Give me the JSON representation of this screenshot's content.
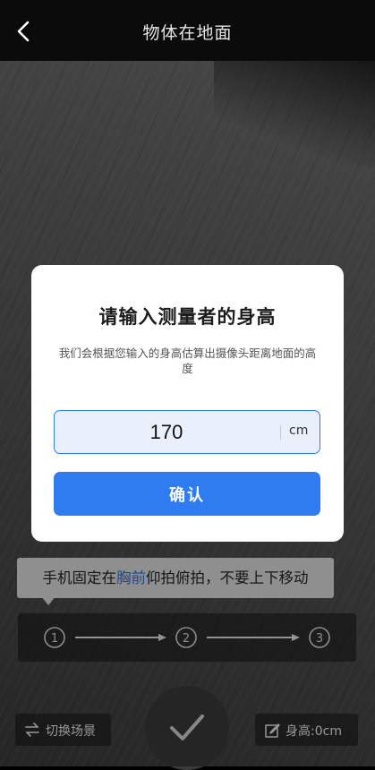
{
  "header": {
    "title": "物体在地面",
    "back_icon": "chevron-left-icon"
  },
  "dialog": {
    "title": "请输入测量者的身高",
    "description": "我们会根据您输入的身高估算出摄像头距离地面的高度",
    "height_value": "170",
    "unit": "cm",
    "confirm_label": "确认",
    "accent_color": "#2f7bf0"
  },
  "tip": {
    "prefix": "手机固定在",
    "highlight": "胸前",
    "suffix": "仰拍俯拍，不要上下移动",
    "highlight_color": "#2f6fd6"
  },
  "steps": {
    "labels": [
      "1",
      "2",
      "3"
    ]
  },
  "bottom": {
    "scene_label": "切换场景",
    "scene_icon": "swap-icon",
    "shutter_icon": "checkmark-icon",
    "height_label": "身高:0cm",
    "height_icon": "edit-icon"
  }
}
